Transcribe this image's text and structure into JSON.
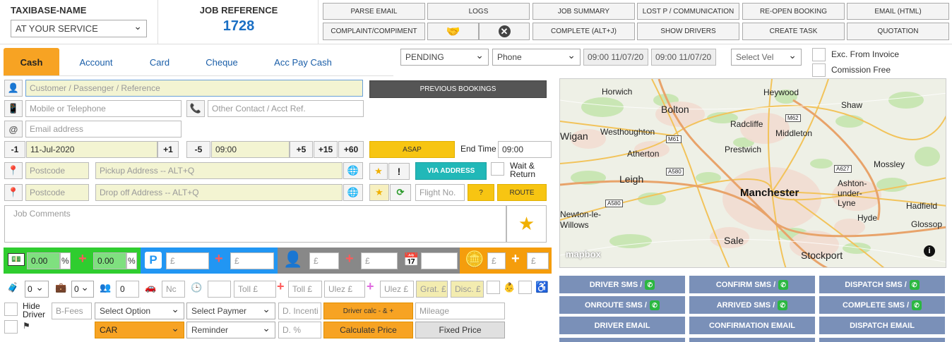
{
  "header": {
    "taxibase_label": "TAXIBASE-NAME",
    "taxibase_value": "AT YOUR SERVICE",
    "jobref_label": "JOB REFERENCE",
    "jobref_value": "1728"
  },
  "toolbar": {
    "parse_email": "PARSE EMAIL",
    "logs": "LOGS",
    "job_summary": "JOB SUMMARY",
    "lost_p": "LOST P / COMMUNICATION",
    "reopen": "RE-OPEN BOOKING",
    "email_html": "EMAIL (HTML)",
    "complaint": "COMPLAINT/COMPIMENT",
    "complete": "COMPLETE (ALT+J)",
    "show_drivers": "SHOW DRIVERS",
    "create_task": "CREATE TASK",
    "quotation": "QUOTATION"
  },
  "tabs": [
    "Cash",
    "Account",
    "Card",
    "Cheque",
    "Acc Pay Cash"
  ],
  "status": {
    "status": "PENDING",
    "source": "Phone",
    "time1": "09:00 11/07/20",
    "time2": "09:00 11/07/20",
    "vehicle": "Select Vel",
    "exc_invoice": "Exc. From Invoice",
    "commission_free": "Comission Free"
  },
  "form": {
    "customer_placeholder": "Customer / Passenger / Reference",
    "mobile_placeholder": "Mobile or Telephone",
    "other_contact_placeholder": "Other Contact / Acct Ref.",
    "email_placeholder": "Email address",
    "date_minus": "-1",
    "date": "11-Jul-2020",
    "date_plus": "+1",
    "time_minus": "-5",
    "time": "09:00",
    "time_plus5": "+5",
    "time_plus15": "+15",
    "time_plus60": "+60",
    "previous_bookings": "PREVIOUS BOOKINGS",
    "asap": "ASAP",
    "end_time_label": "End Time",
    "end_time": "09:00",
    "postcode_placeholder": "Postcode",
    "pickup_placeholder": "Pickup Address -- ALT+Q",
    "dropoff_placeholder": "Drop off Address -- ALT+Q",
    "via_address": "VIA ADDRESS",
    "wait_return": "Wait & Return",
    "flight_placeholder": "Flight No.",
    "question": "?",
    "route": "ROUTE",
    "comments_placeholder": "Job Comments",
    "exclaim": "!"
  },
  "money": {
    "pct1": "0.00",
    "pct2": "0.00",
    "pct_sign": "%",
    "pound": "£"
  },
  "extras": {
    "qty1": "0",
    "qty2": "0",
    "qty3": "0",
    "nc": "Nc",
    "toll1": "Toll £",
    "toll2": "Toll £",
    "ulez1": "Ulez £",
    "ulez2": "Ulez £",
    "grat": "Grat. £",
    "disc": "Disc. £",
    "hide_driver": "Hide Driver",
    "bfees": "B-Fees",
    "select_option": "Select Option",
    "select_payment": "Select Paymer",
    "d_incentive": "D. Incenti",
    "driver_calc": "Driver calc - & +",
    "mileage": "Mileage",
    "car": "CAR",
    "reminder": "Reminder",
    "d_pct": "D. %",
    "calculate_price": "Calculate Price",
    "fixed_price": "Fixed Price"
  },
  "map": {
    "logo": "mapbox",
    "labels": [
      "Horwich",
      "Heywood",
      "Bolton",
      "Shaw",
      "Radcliffe",
      "Middleton",
      "Wigan",
      "Westhoughton",
      "Prestwich",
      "Atherton",
      "Mossley",
      "Leigh",
      "Manchester",
      "Ashton-under-Lyne",
      "Hadfield",
      "Newton-le-Willows",
      "Hyde",
      "Glossop",
      "Sale",
      "Stockport"
    ],
    "roads": [
      "M62",
      "M61",
      "A580",
      "A627",
      "A580"
    ]
  },
  "actions": {
    "driver_sms": "DRIVER SMS /",
    "confirm_sms": "CONFIRM SMS /",
    "dispatch_sms": "DISPATCH SMS /",
    "onroute_sms": "ONROUTE SMS /",
    "arrived_sms": "ARRIVED SMS /",
    "complete_sms": "COMPLETE SMS /",
    "driver_email": "DRIVER EMAIL",
    "confirmation_email": "CONFIRMATION EMAIL",
    "dispatch_email": "DISPATCH EMAIL"
  },
  "colors": {
    "orange": "#f7a323",
    "green": "#2fcd2f",
    "blue": "#2196f3",
    "gray": "#888888",
    "gold": "#f59d0c",
    "action_blue": "#7a90b8"
  }
}
